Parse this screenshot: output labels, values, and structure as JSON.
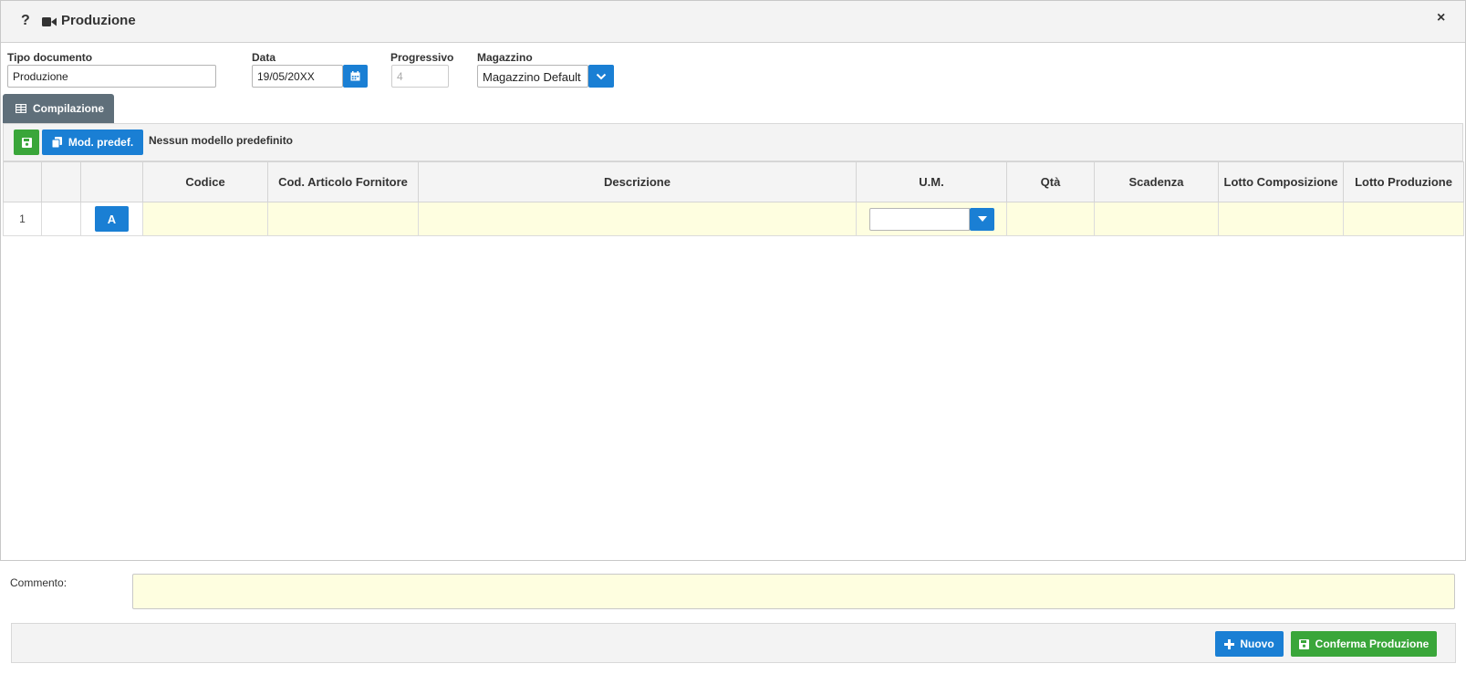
{
  "window": {
    "title": "Produzione",
    "help_glyph": "?",
    "close_glyph": "×"
  },
  "form": {
    "tipo_documento": {
      "label": "Tipo documento",
      "value": "Produzione"
    },
    "data": {
      "label": "Data",
      "value": "19/05/20XX"
    },
    "progressivo": {
      "label": "Progressivo",
      "value": "4"
    },
    "magazzino": {
      "label": "Magazzino",
      "value": "Magazzino Default"
    }
  },
  "tabs": [
    {
      "label": "Compilazione",
      "icon": "table-icon"
    }
  ],
  "toolbar": {
    "mod_predef_label": "Mod. predef.",
    "status_text": "Nessun modello predefinito"
  },
  "grid": {
    "columns": [
      "",
      "",
      "",
      "Codice",
      "Cod. Articolo Fornitore",
      "Descrizione",
      "U.M.",
      "Qtà",
      "Scadenza",
      "Lotto Composizione",
      "Lotto Produzione"
    ],
    "rows": [
      {
        "num": "1",
        "action_label": "A"
      }
    ]
  },
  "comment": {
    "label": "Commento:"
  },
  "footer": {
    "nuovo_label": "Nuovo",
    "conferma_label": "Conferma Produzione"
  },
  "colors": {
    "accent_blue": "#1a7fd4",
    "accent_green": "#3aa63a",
    "editable_yellow": "#fefee0",
    "tab_gray": "#5f6f7a"
  }
}
